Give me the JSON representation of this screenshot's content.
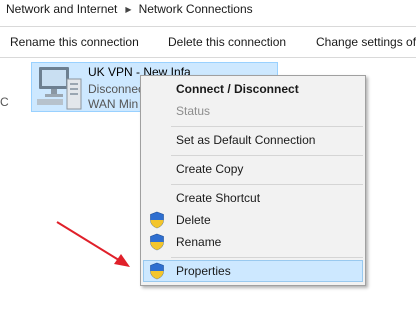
{
  "breadcrumb": {
    "items": [
      "Network and Internet",
      "Network Connections"
    ]
  },
  "toolbar": {
    "rename": "Rename this connection",
    "delete": "Delete this connection",
    "change": "Change settings of"
  },
  "left_fragment": "C",
  "connection": {
    "name": "UK VPN - New Infa",
    "status": "Disconnec",
    "device": "WAN Min"
  },
  "context_menu": {
    "connect": "Connect / Disconnect",
    "status": "Status",
    "set_default": "Set as Default Connection",
    "create_copy": "Create Copy",
    "create_shortcut": "Create Shortcut",
    "delete": "Delete",
    "rename": "Rename",
    "properties": "Properties"
  },
  "colors": {
    "selection": "#cde8ff",
    "annotation_arrow": "#e0202a"
  }
}
